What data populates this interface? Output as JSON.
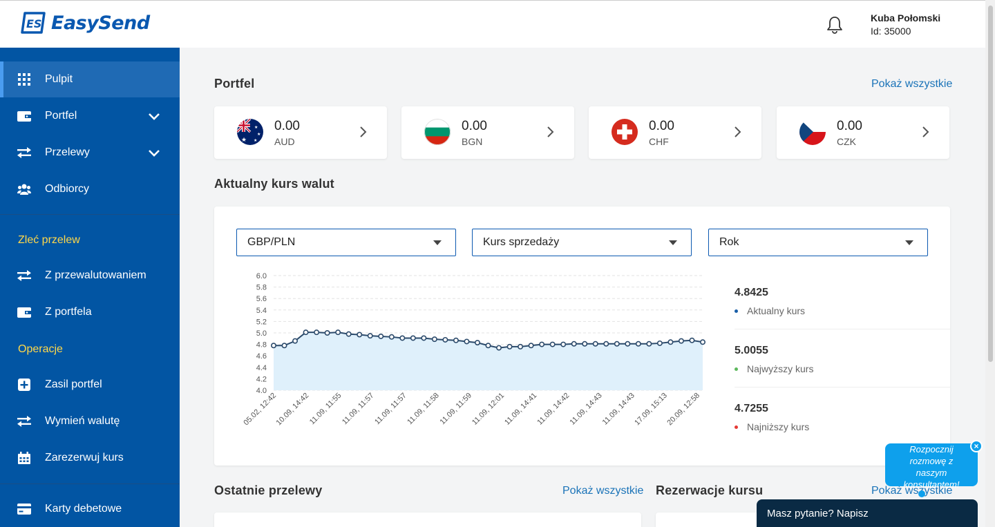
{
  "header": {
    "logo_text": "EasySend",
    "user_name": "Kuba Połomski",
    "user_id": "Id: 35000"
  },
  "sidebar": {
    "items": [
      {
        "label": "Pulpit",
        "icon": "grid-icon"
      },
      {
        "label": "Portfel",
        "icon": "wallet-icon"
      },
      {
        "label": "Przelewy",
        "icon": "transfer-icon"
      },
      {
        "label": "Odbiorcy",
        "icon": "users-icon"
      }
    ],
    "section_order": "Zleć przelew",
    "order_items": [
      {
        "label": "Z przewalutowaniem",
        "icon": "transfer-icon"
      },
      {
        "label": "Z portfela",
        "icon": "wallet-icon"
      }
    ],
    "section_operations": "Operacje",
    "operation_items": [
      {
        "label": "Zasil portfel",
        "icon": "plus-square-icon"
      },
      {
        "label": "Wymień walutę",
        "icon": "transfer-icon"
      },
      {
        "label": "Zarezerwuj kurs",
        "icon": "calendar-icon"
      }
    ],
    "cards_item": {
      "label": "Karty debetowe",
      "icon": "credit-card-icon"
    }
  },
  "portfolio": {
    "title": "Portfel",
    "show_all": "Pokaż wszystkie",
    "wallets": [
      {
        "amount": "0.00",
        "code": "AUD",
        "flag": "australia"
      },
      {
        "amount": "0.00",
        "code": "BGN",
        "flag": "bulgaria"
      },
      {
        "amount": "0.00",
        "code": "CHF",
        "flag": "switzerland"
      },
      {
        "amount": "0.00",
        "code": "CZK",
        "flag": "czech"
      }
    ]
  },
  "rates": {
    "title": "Aktualny kurs walut",
    "pair_select": "GBP/PLN",
    "type_select": "Kurs sprzedaży",
    "period_select": "Rok",
    "stats": [
      {
        "value": "4.8425",
        "label": "Aktualny kurs",
        "color": "#1a5fa8"
      },
      {
        "value": "5.0055",
        "label": "Najwyższy kurs",
        "color": "#5cb85c"
      },
      {
        "value": "4.7255",
        "label": "Najniższy kurs",
        "color": "#e53935"
      }
    ]
  },
  "recent_transfers": {
    "title": "Ostatnie przelewy",
    "show_all": "Pokaż wszystkie"
  },
  "reservations": {
    "title": "Rezerwacje kursu",
    "show_all": "Pokaż wszystkie"
  },
  "chat": {
    "bubble_text": "Rozpocznij rozmowę z naszym konsultantem!",
    "close": "×",
    "bar_text": "Masz pytanie? Napisz"
  },
  "chart_data": {
    "type": "area",
    "title": "",
    "xlabel": "",
    "ylabel": "",
    "ylim": [
      4.0,
      6.0
    ],
    "yticks": [
      "6.0",
      "5.8",
      "5.6",
      "5.4",
      "5.2",
      "5.0",
      "4.8",
      "4.6",
      "4.4",
      "4.2",
      "4.0"
    ],
    "x_tick_labels": [
      "05.02, 12:42",
      "10.09, 14:42",
      "11.09, 11:55",
      "11.09, 11:57",
      "11.09, 11:57",
      "11.09, 11:58",
      "11.09, 11:59",
      "11.09, 12:01",
      "11.09, 14:41",
      "11.09, 14:42",
      "11.09, 14:43",
      "11.09, 14:43",
      "17.09, 15:13",
      "20.09, 12:58"
    ],
    "values": [
      4.78,
      4.78,
      4.86,
      5.01,
      5.01,
      5.0,
      5.01,
      4.98,
      4.97,
      4.95,
      4.94,
      4.93,
      4.91,
      4.91,
      4.91,
      4.89,
      4.88,
      4.87,
      4.85,
      4.83,
      4.78,
      4.74,
      4.76,
      4.76,
      4.78,
      4.8,
      4.8,
      4.8,
      4.81,
      4.81,
      4.81,
      4.81,
      4.81,
      4.81,
      4.81,
      4.81,
      4.82,
      4.84,
      4.86,
      4.87,
      4.84
    ],
    "line_color": "#2b4a6b",
    "fill_color": "#dff0fb",
    "grid": true
  }
}
